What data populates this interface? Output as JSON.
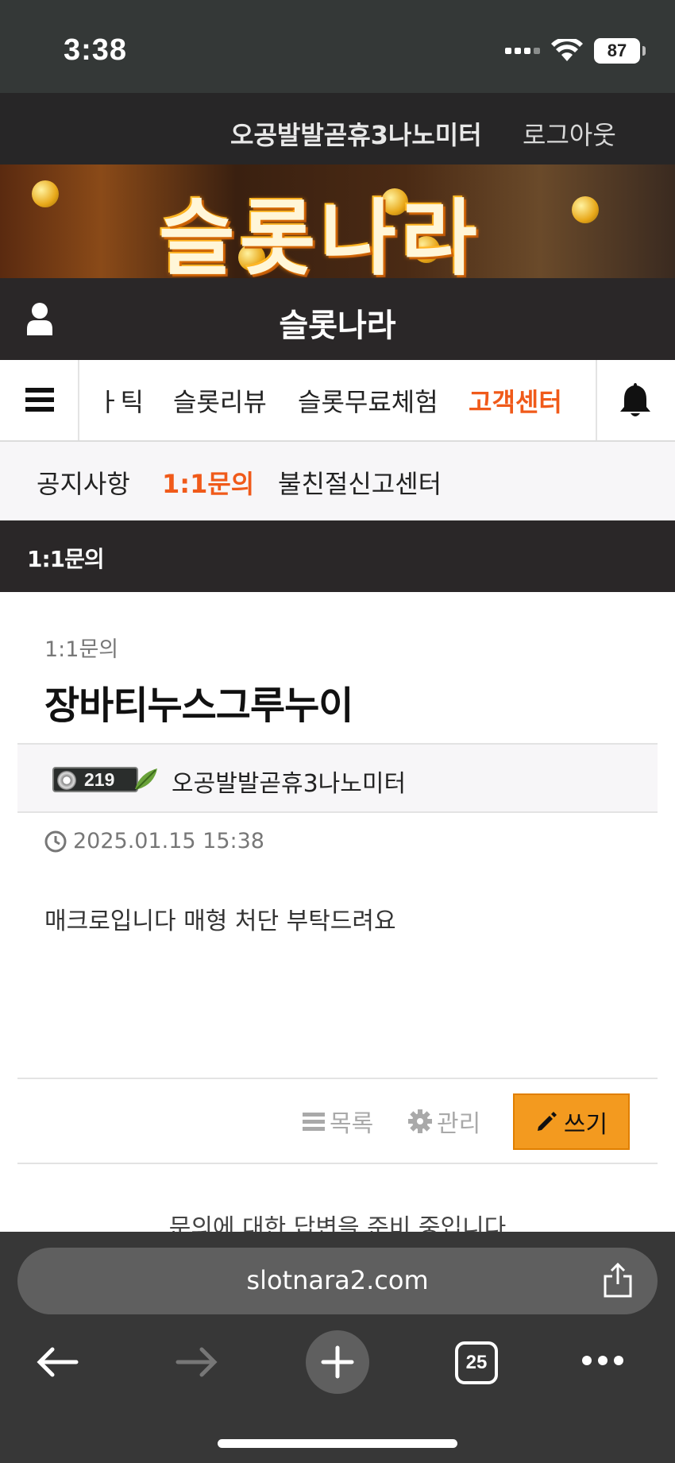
{
  "status_bar": {
    "time": "3:38",
    "battery": "87",
    "icons": [
      "signal-icon",
      "wifi-icon",
      "battery-icon"
    ]
  },
  "top_bar": {
    "username": "오공발발곧휴3나노미터",
    "logout": "로그아웃"
  },
  "banner": {
    "title": "슬롯나라"
  },
  "site_header": {
    "title": "슬롯나라",
    "icons": [
      "user-icon"
    ]
  },
  "main_nav": {
    "items": [
      {
        "label": "ㅏ틱",
        "active": false
      },
      {
        "label": "슬롯리뷰",
        "active": false
      },
      {
        "label": "슬롯무료체험",
        "active": false
      },
      {
        "label": "고객센터",
        "active": true
      }
    ],
    "icons": [
      "menu-icon",
      "bell-icon"
    ],
    "accent_color": "#f05a1a"
  },
  "sub_nav": {
    "items": [
      {
        "label": "공지사항",
        "active": false
      },
      {
        "label": "1:1문의",
        "active": true
      },
      {
        "label": "불친절신고센터",
        "active": false
      }
    ]
  },
  "page_heading": "1:1문의",
  "post": {
    "category": "1:1문의",
    "title": "장바티누스그루누이",
    "author_level": "219",
    "author_name": "오공발발곧휴3나노미터",
    "date": "2025.01.15 15:38",
    "body": "매크로입니다 매형 처단 부탁드려요"
  },
  "actions": {
    "list_label": "목록",
    "admin_label": "관리",
    "write_label": "쓰기",
    "write_color": "#f39a1f"
  },
  "answer_note": "문의에 대한 답변을 준비 중입니다",
  "browser": {
    "url": "slotnara2.com",
    "tab_count": "25",
    "icons": [
      "share-icon",
      "back-arrow-icon",
      "forward-arrow-icon",
      "plus-icon",
      "tabs-icon",
      "more-icon"
    ]
  }
}
